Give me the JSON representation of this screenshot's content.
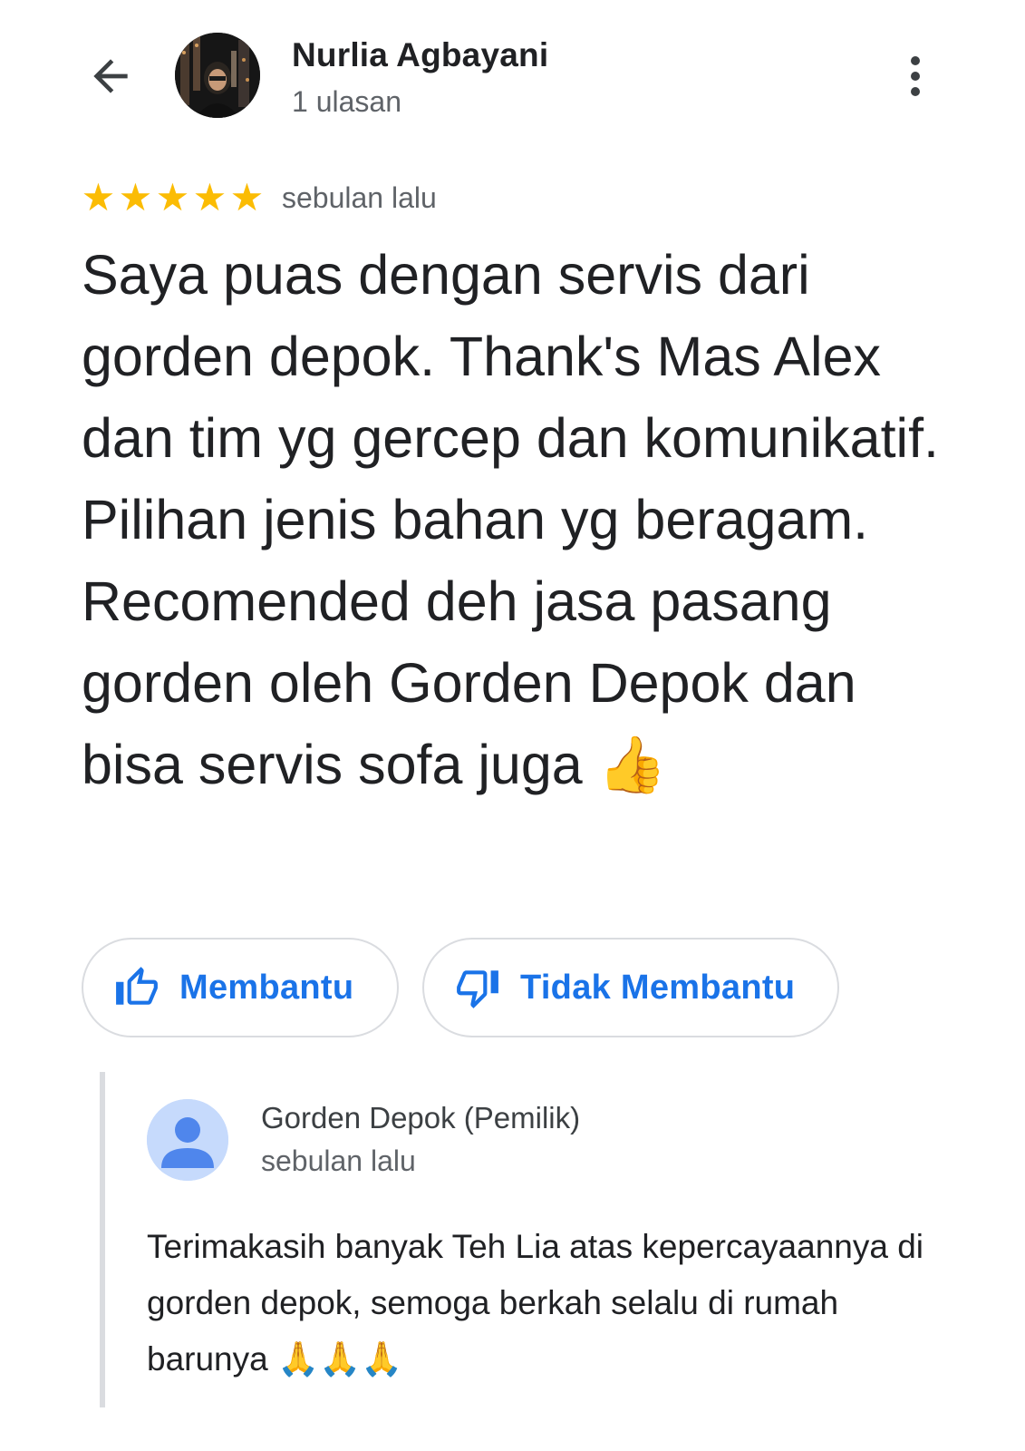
{
  "header": {
    "back_icon": "arrow-left-icon",
    "reviewer_name": "Nurlia Agbayani",
    "review_count": "1 ulasan",
    "more_icon": "more-vert-icon"
  },
  "review": {
    "rating": 5,
    "rating_max": 5,
    "star_color": "#fbbc04",
    "date": "sebulan lalu",
    "text": "Saya puas dengan servis dari gorden depok. Thank's Mas Alex dan tim yg gercep dan komunikatif. Pilihan jenis bahan yg beragam. Recomended deh jasa pasang gorden oleh Gorden Depok dan bisa servis sofa juga 👍"
  },
  "actions": {
    "helpful_label": "Membantu",
    "helpful_icon": "thumbs-up-icon",
    "unhelpful_label": "Tidak Membantu",
    "unhelpful_icon": "thumbs-down-icon",
    "accent_color": "#1a73e8"
  },
  "owner_reply": {
    "name": "Gorden Depok (Pemilik)",
    "date": "sebulan lalu",
    "avatar_icon": "person-icon",
    "text": "Terimakasih banyak Teh Lia atas kepercayaannya di gorden depok, semoga berkah selalu di rumah barunya 🙏🙏🙏"
  }
}
